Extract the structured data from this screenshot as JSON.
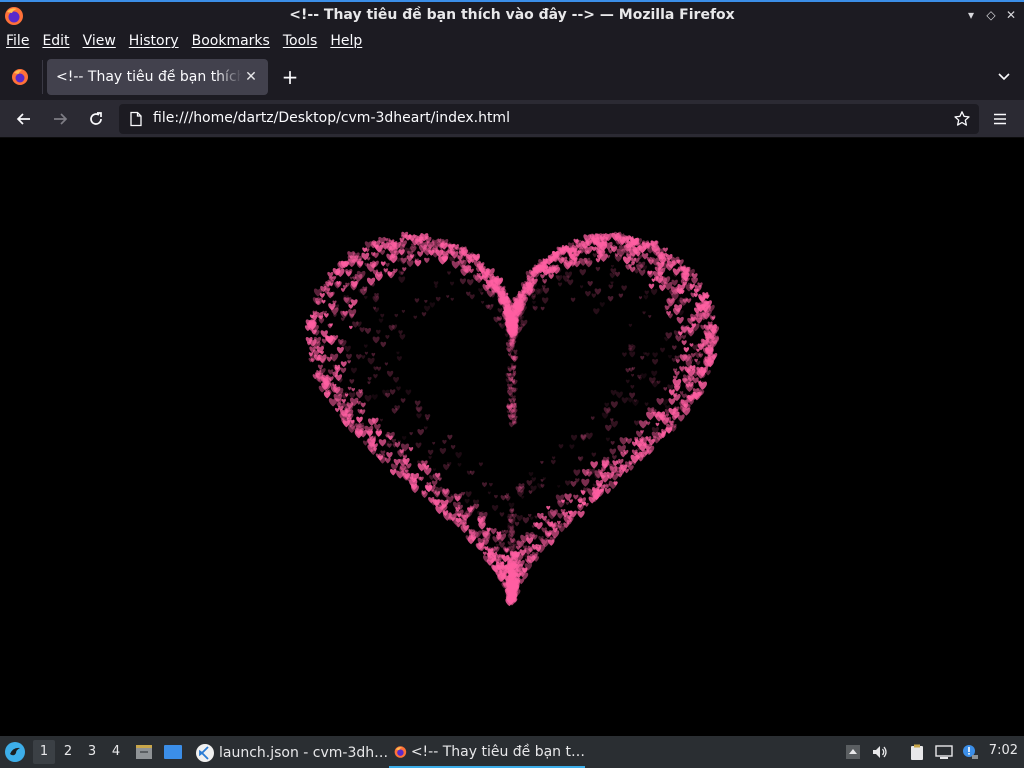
{
  "window": {
    "title": "<!-- Thay tiêu đề bạn thích vào đây --> — Mozilla Firefox"
  },
  "menubar": {
    "items": [
      "File",
      "Edit",
      "View",
      "History",
      "Bookmarks",
      "Tools",
      "Help"
    ]
  },
  "tabs": [
    {
      "label": "<!-- Thay tiêu đề bạn thích vào đây -->",
      "active": true
    }
  ],
  "navbar": {
    "url": "file:///home/dartz/Desktop/cvm-3dheart/index.html"
  },
  "page": {
    "background": "#000000",
    "heart_color": "#ff5fa2"
  },
  "taskbar": {
    "workspaces": [
      "1",
      "2",
      "3",
      "4"
    ],
    "active_workspace": "1",
    "tasks": [
      {
        "label": "launch.json - cvm-3dh…",
        "icon": "vscode-icon",
        "active": false
      },
      {
        "label": "<!-- Thay tiêu đề bạn t…",
        "icon": "firefox-icon",
        "active": true
      }
    ],
    "clock": "7:02"
  },
  "colors": {
    "titlebar": "#1c1b22",
    "toolbar": "#2b2a33",
    "tab_active": "#42414d",
    "taskbar": "#2a2e32",
    "accent": "#3daee9"
  }
}
